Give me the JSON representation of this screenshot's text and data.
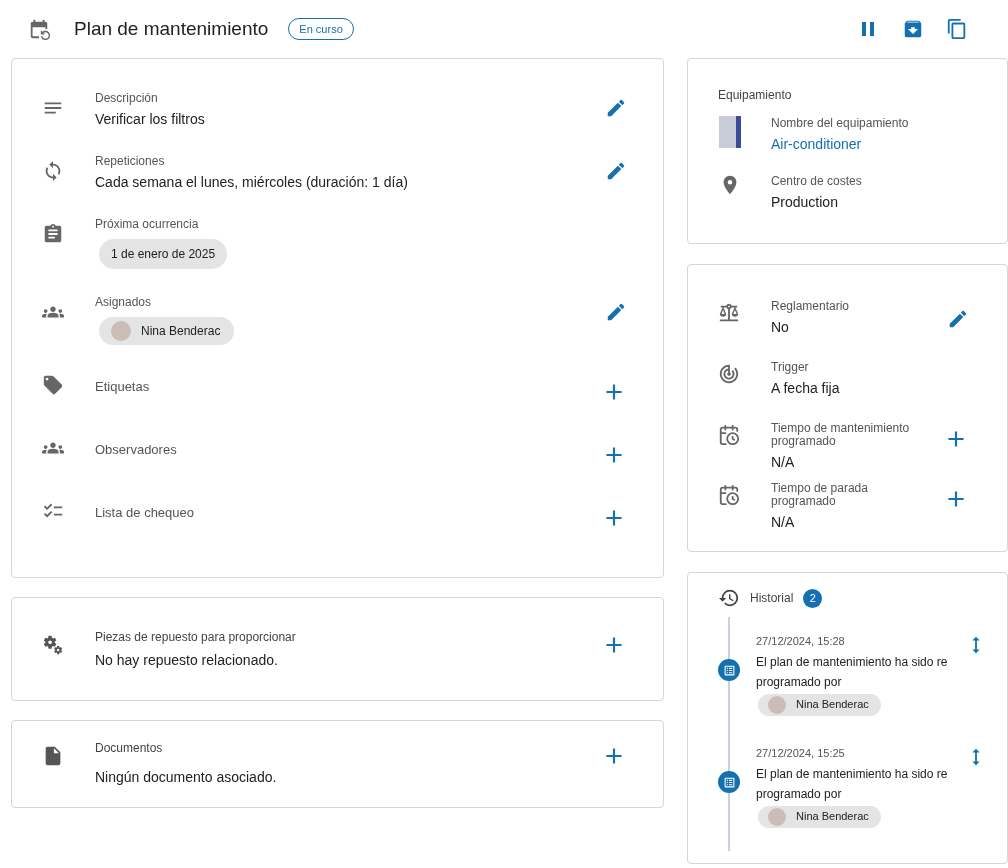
{
  "header": {
    "title": "Plan de mantenimiento",
    "status": "En curso"
  },
  "details": [
    {
      "kind": "text",
      "label": "Descripción",
      "value": "Verificar los filtros",
      "editable": true,
      "addable": false
    },
    {
      "kind": "text",
      "label": "Repeticiones",
      "value": "Cada semana el lunes, miércoles (duración: 1 día)",
      "editable": true,
      "addable": false
    },
    {
      "kind": "chip",
      "label": "Próxima ocurrencia",
      "value": "1 de enero de 2025",
      "editable": false,
      "addable": false
    },
    {
      "kind": "person",
      "label": "Asignados",
      "value": "Nina Benderac",
      "editable": true,
      "addable": false
    },
    {
      "kind": "empty",
      "label": "Etiquetas",
      "editable": false,
      "addable": true
    },
    {
      "kind": "empty",
      "label": "Observadores",
      "editable": false,
      "addable": true
    },
    {
      "kind": "empty",
      "label": "Lista de chequeo",
      "editable": false,
      "addable": true
    }
  ],
  "spare_parts": {
    "label": "Piezas de repuesto para proporcionar",
    "value": "No hay repuesto relacionado.",
    "addable": true
  },
  "documents": {
    "label": "Documentos",
    "value": "Ningún documento asociado.",
    "addable": true
  },
  "equipment": {
    "title": "Equipamiento",
    "items": [
      {
        "kind": "link",
        "label": "Nombre del equipamiento",
        "value": "Air-conditioner"
      },
      {
        "kind": "text",
        "label": "Centro de costes",
        "value": "Production"
      }
    ]
  },
  "settings": [
    {
      "label": "Reglamentario",
      "value": "No",
      "editable": true,
      "addable": false
    },
    {
      "label": "Trigger",
      "value": "A fecha fija",
      "editable": false,
      "addable": false
    },
    {
      "label": "Tiempo de mantenimiento programado",
      "value": "N/A",
      "editable": false,
      "addable": true
    },
    {
      "label": "Tiempo de parada programado",
      "value": "N/A",
      "editable": false,
      "addable": true
    }
  ],
  "history": {
    "title": "Historial",
    "count": "2",
    "entries": [
      {
        "time": "27/12/2024, 15:28",
        "text": "El plan de mantenimiento ha sido reprogramado por",
        "user": "Nina Benderac"
      },
      {
        "time": "27/12/2024, 15:25",
        "text": "El plan de mantenimiento ha sido reprogramado por",
        "user": "Nina Benderac"
      }
    ]
  }
}
